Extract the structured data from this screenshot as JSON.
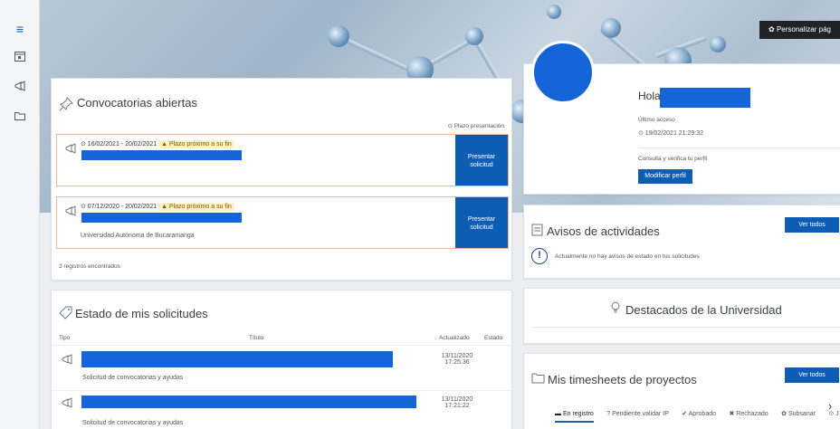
{
  "sidebar": {
    "icons": [
      "menu-icon",
      "calendar-icon",
      "megaphone-icon",
      "folder-icon"
    ]
  },
  "header": {
    "personalize_label": "✿ Personalizar pág"
  },
  "convocatorias": {
    "title": "Convocatorias abiertas",
    "deadline_header": "⊙ Plazo presentación",
    "items": [
      {
        "dates": "⊙ 16/02/2021 - 20/02/2021",
        "warning": "▲ Plazo próximo a su fin",
        "subtitle": "",
        "button": "Presentar\nsolicitud"
      },
      {
        "dates": "⊙ 07/12/2020 - 20/02/2021",
        "warning": "▲ Plazo próximo a su fin",
        "subtitle": "Universidad Autónoma de Bucaramanga",
        "button": "Presentar\nsolicitud"
      }
    ],
    "footer": "3 registros encontrados"
  },
  "profile": {
    "greeting": "Hola",
    "last_access_label": "Último acceso",
    "last_access_value": "⊙ 19/02/2021 21:29:32",
    "verify_text": "Consulta y verifica tu perfil",
    "edit_button": "Modificar perfil"
  },
  "avisos": {
    "title": "Avisos de actividades",
    "view_all": "Ver todos",
    "message": "Actualmente no hay avisos de estado en tus solicitudes"
  },
  "destacados": {
    "title": "Destacados de la Universidad"
  },
  "estado": {
    "title": "Estado de mis solicitudes",
    "columns": {
      "tipo": "Tipo",
      "titulo": "Título",
      "actualizado": "Actualizado",
      "estado": "Estado"
    },
    "rows": [
      {
        "subtitle": "Solicitud de convocatorias y ayudas",
        "date": "13/11/2020",
        "time": "17:25:36"
      },
      {
        "subtitle": "Solicitud de convocatorias y ayudas",
        "date": "13/11/2020",
        "time": "17:21:22"
      }
    ]
  },
  "timesheets": {
    "title": "Mis timesheets de proyectos",
    "view_all": "Ver todos",
    "tabs": [
      "En registro",
      "? Pendiente validar IP",
      "✔ Aprobado",
      "✖ Rechazado",
      "✿ Subsanar",
      "⊙ J"
    ]
  }
}
